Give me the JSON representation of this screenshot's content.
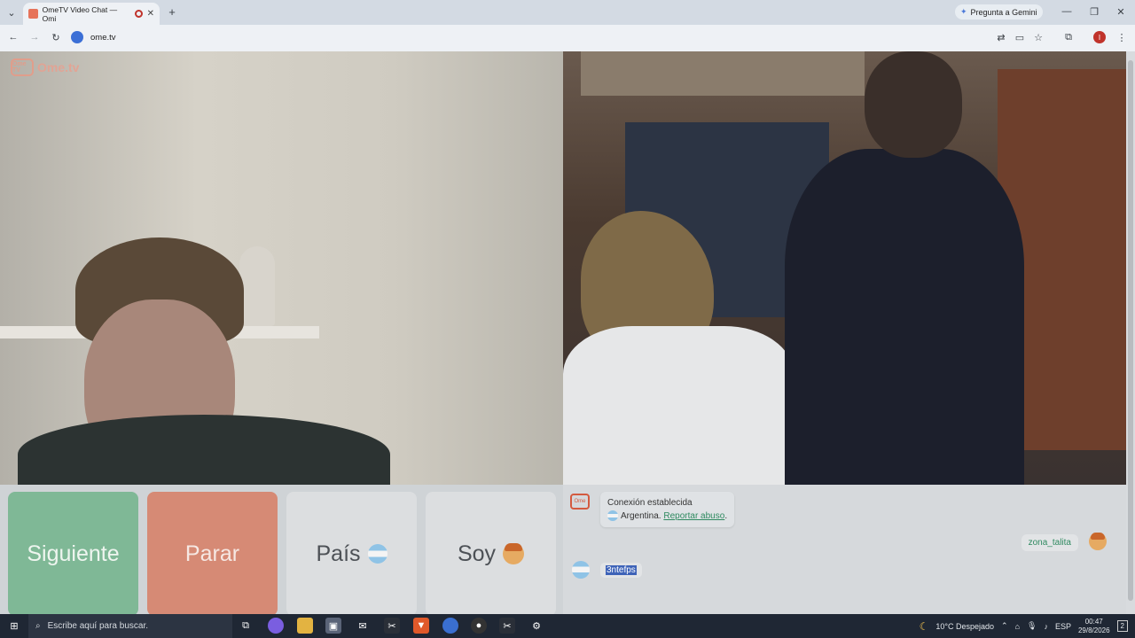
{
  "browser": {
    "tab_title": "OmeTV Video Chat — Omi",
    "new_tab": "+",
    "gemini_label": "Pregunta a Gemini",
    "url": "ome.tv",
    "window_controls": {
      "minimize": "—",
      "restore": "❐",
      "close": "✕"
    }
  },
  "site": {
    "logo_text": "Ome.tv",
    "logo_badge": "Ome TV"
  },
  "controls": {
    "next_label": "Siguiente",
    "stop_label": "Parar",
    "country_label": "País",
    "me_label": "Soy"
  },
  "chat": {
    "system_line1": "Conexión establecida",
    "system_country": "Argentina.",
    "system_abuse": "Reportar abuso",
    "system_abuse_suffix": ".",
    "my_message": "zona_talita",
    "peer_message": "3ntefps"
  },
  "taskbar": {
    "search_placeholder": "Escribe aquí para buscar.",
    "weather": "10°C  Despejado",
    "lang": "ESP",
    "time": "00:47",
    "date": "29/8/2026",
    "notif_count": "2"
  }
}
